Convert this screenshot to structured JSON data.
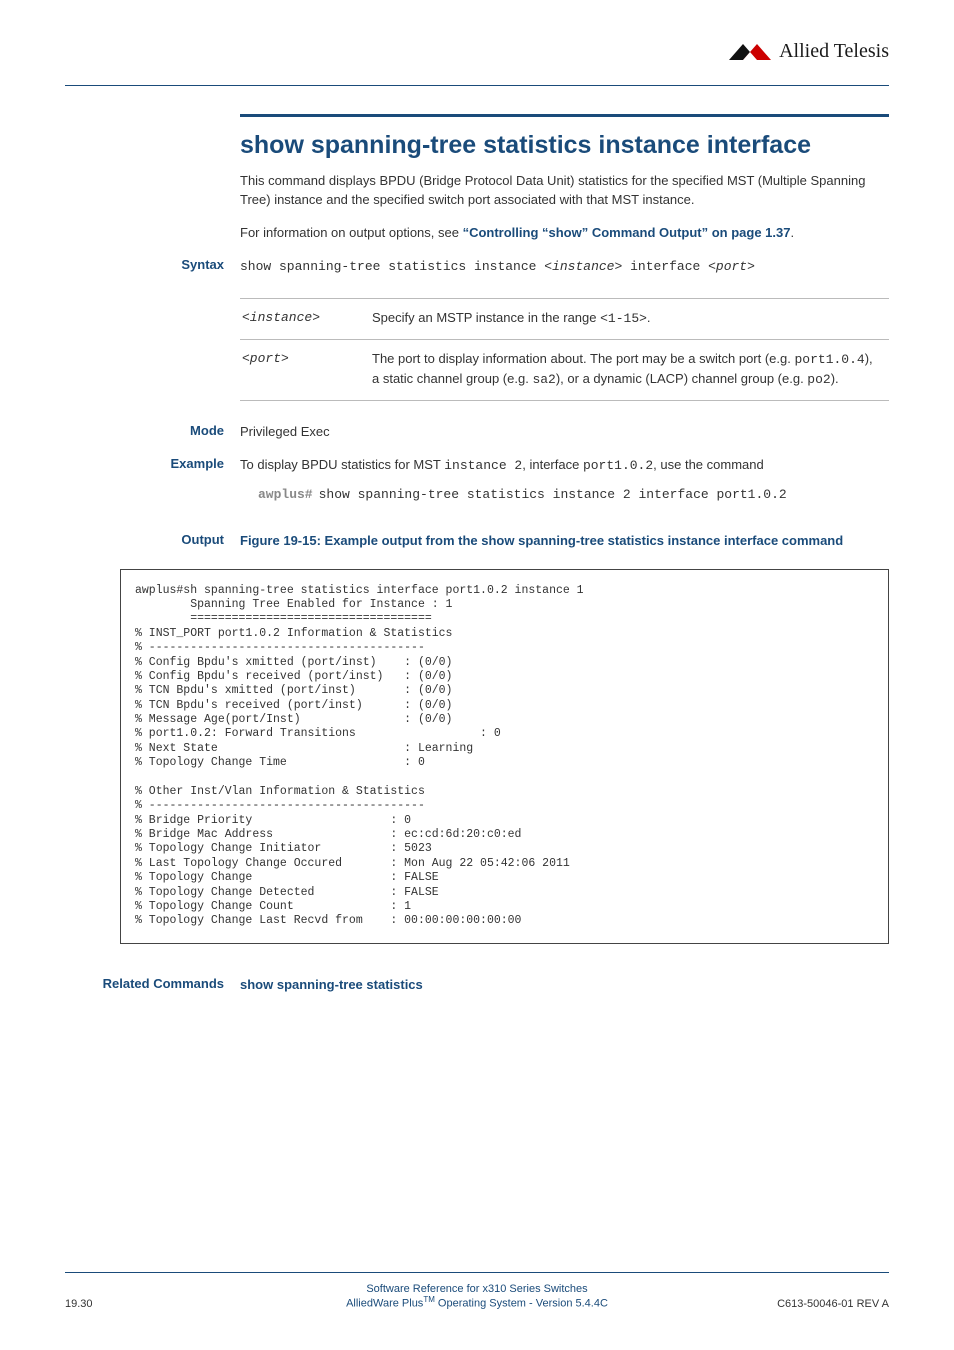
{
  "logo": {
    "brand": "Allied Telesis",
    "brand_aria": "Allied Telesis logo"
  },
  "title": "show spanning-tree statistics instance interface",
  "intro_p1": "This command displays BPDU (Bridge Protocol Data Unit) statistics for the specified MST (Multiple Spanning Tree) instance and the specified switch port associated with that MST instance.",
  "intro_p2_pre": "For information on output options, see ",
  "intro_p2_link": "“Controlling “show” Command Output” on page 1.37",
  "intro_p2_post": ".",
  "labels": {
    "syntax": "Syntax",
    "mode": "Mode",
    "example": "Example",
    "output": "Output",
    "related": "Related Commands"
  },
  "syntax_line": "show spanning-tree statistics instance <instance> interface <port>",
  "params": {
    "instance": {
      "name": "<instance>",
      "desc_pre": "Specify an MSTP instance in the range ",
      "desc_code": "<1-15>",
      "desc_post": "."
    },
    "port": {
      "name": "<port>",
      "desc_pre": "The port to display information about. The port may be a switch port (e.g. ",
      "code1": "port1.0.4",
      "mid1": "), a static channel group (e.g. ",
      "code2": "sa2",
      "mid2": "), or a dynamic (LACP) channel group (e.g. ",
      "code3": "po2",
      "post": ")."
    }
  },
  "mode_value": "Privileged Exec",
  "example": {
    "pre": "To display BPDU statistics for MST ",
    "code1": "instance 2",
    "mid1": ", interface ",
    "code2": "port1.0.2",
    "post": ", use the command",
    "prompt": "awplus#",
    "cmd": "show spanning-tree statistics instance 2 interface port1.0.2"
  },
  "figure_caption": "Figure 19-15: Example output from the show spanning-tree statistics instance interface command",
  "output_text": "awplus#sh spanning-tree statistics interface port1.0.2 instance 1\n        Spanning Tree Enabled for Instance : 1\n        ===================================\n% INST_PORT port1.0.2 Information & Statistics\n% ----------------------------------------\n% Config Bpdu's xmitted (port/inst)    : (0/0)\n% Config Bpdu's received (port/inst)   : (0/0)\n% TCN Bpdu's xmitted (port/inst)       : (0/0)\n% TCN Bpdu's received (port/inst)      : (0/0)\n% Message Age(port/Inst)               : (0/0)\n% port1.0.2: Forward Transitions                  : 0\n% Next State                           : Learning\n% Topology Change Time                 : 0\n\n% Other Inst/Vlan Information & Statistics\n% ----------------------------------------\n% Bridge Priority                    : 0\n% Bridge Mac Address                 : ec:cd:6d:20:c0:ed\n% Topology Change Initiator          : 5023\n% Last Topology Change Occured       : Mon Aug 22 05:42:06 2011\n% Topology Change                    : FALSE\n% Topology Change Detected           : FALSE\n% Topology Change Count              : 1\n% Topology Change Last Recvd from    : 00:00:00:00:00:00",
  "related_link": "show spanning-tree statistics",
  "footer": {
    "left": "19.30",
    "line1": "Software Reference for x310 Series Switches",
    "line2_pre": "AlliedWare Plus",
    "line2_tm": "TM",
    "line2_post": " Operating System  - Version 5.4.4C",
    "right": "C613-50046-01 REV A"
  }
}
